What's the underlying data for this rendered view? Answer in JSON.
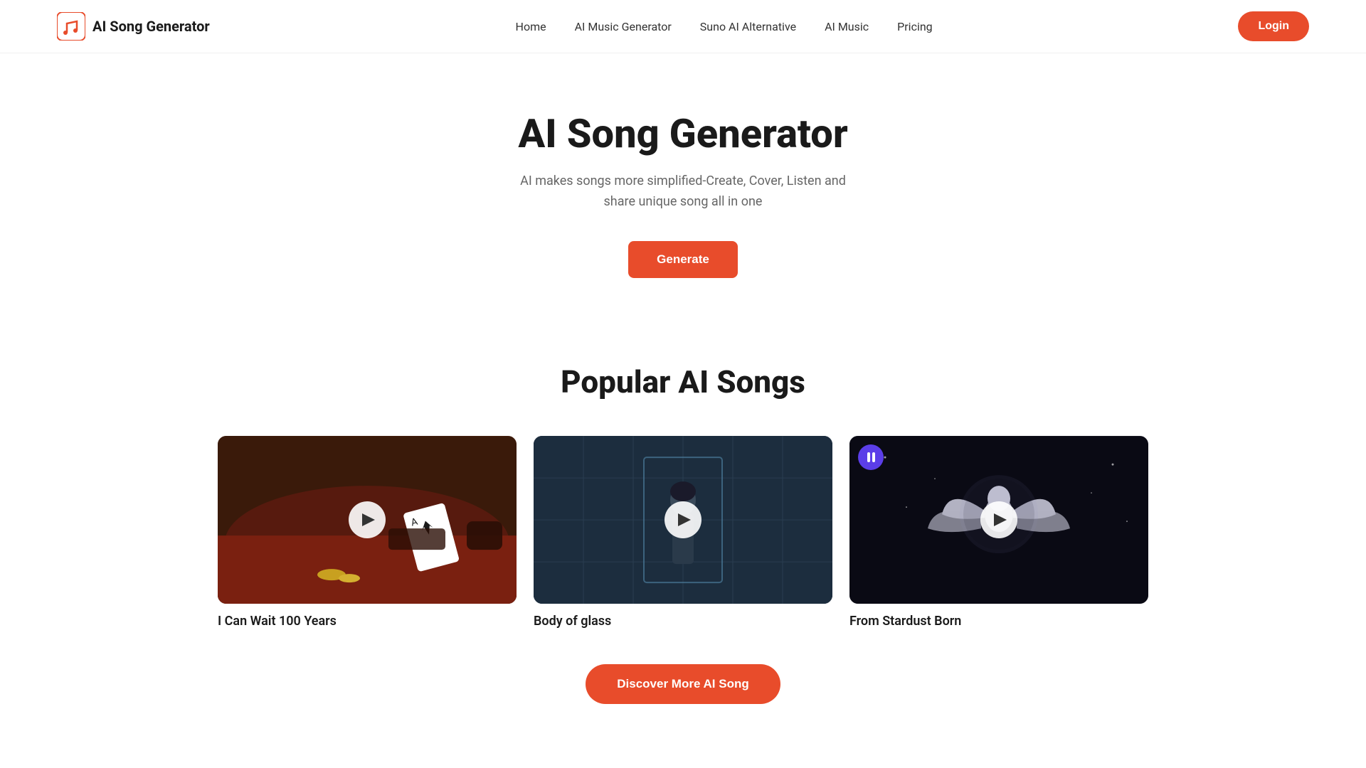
{
  "nav": {
    "logo_text": "AI Song Generator",
    "links": [
      {
        "id": "home",
        "label": "Home"
      },
      {
        "id": "ai-music-generator",
        "label": "AI Music Generator"
      },
      {
        "id": "suno-ai-alternative",
        "label": "Suno AI Alternative"
      },
      {
        "id": "ai-music",
        "label": "AI Music"
      },
      {
        "id": "pricing",
        "label": "Pricing"
      }
    ],
    "login_label": "Login"
  },
  "hero": {
    "title": "AI Song Generator",
    "subtitle": "AI makes songs more simplified-Create, Cover, Listen and share unique song all in one",
    "generate_label": "Generate"
  },
  "popular": {
    "section_title": "Popular AI Songs",
    "songs": [
      {
        "id": "song-1",
        "title": "I Can Wait 100 Years",
        "playing": false
      },
      {
        "id": "song-2",
        "title": "Body of glass",
        "playing": false
      },
      {
        "id": "song-3",
        "title": "From Stardust Born",
        "playing": true
      }
    ],
    "discover_label": "Discover More AI Song"
  }
}
